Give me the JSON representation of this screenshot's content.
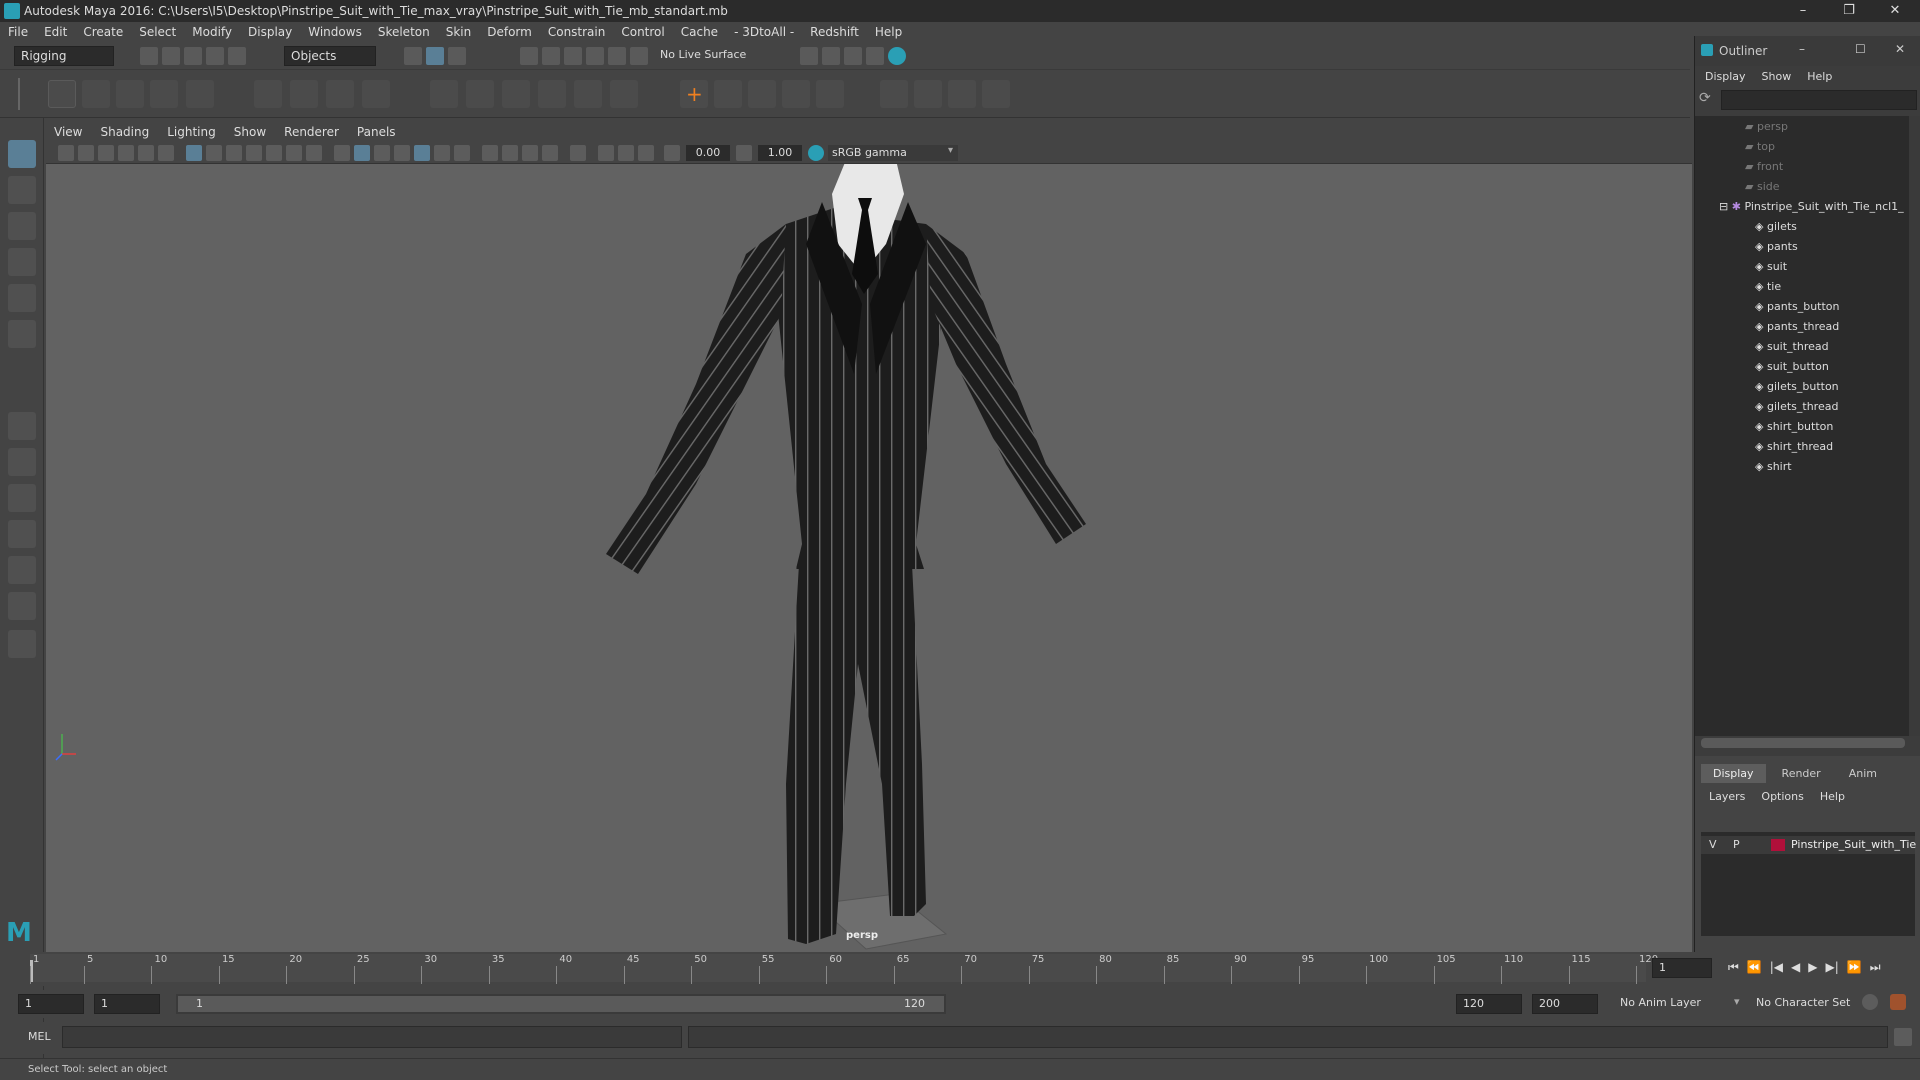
{
  "title": "Autodesk Maya 2016: C:\\Users\\I5\\Desktop\\Pinstripe_Suit_with_Tie_max_vray\\Pinstripe_Suit_with_Tie_mb_standart.mb",
  "menu": [
    "File",
    "Edit",
    "Create",
    "Select",
    "Modify",
    "Display",
    "Windows",
    "Skeleton",
    "Skin",
    "Deform",
    "Constrain",
    "Control",
    "Cache",
    "- 3DtoAll -",
    "Redshift",
    "Help"
  ],
  "status": {
    "mode": "Rigging",
    "select_mode": "Objects",
    "live_surface": "No Live Surface"
  },
  "panel_menu": [
    "View",
    "Shading",
    "Lighting",
    "Show",
    "Renderer",
    "Panels"
  ],
  "panel_toolbar": {
    "exposure": "0.00",
    "gamma": "1.00",
    "color_space": "sRGB gamma"
  },
  "viewport": {
    "camera_label": "persp"
  },
  "outliner": {
    "title": "Outliner",
    "menu": [
      "Display",
      "Show",
      "Help"
    ],
    "cameras": [
      "persp",
      "top",
      "front",
      "side"
    ],
    "root": "Pinstripe_Suit_with_Tie_ncl1_",
    "children": [
      "gilets",
      "pants",
      "suit",
      "tie",
      "pants_button",
      "pants_thread",
      "suit_thread",
      "suit_button",
      "gilets_button",
      "gilets_thread",
      "shirt_button",
      "shirt_thread",
      "shirt"
    ]
  },
  "layers": {
    "tabs": [
      "Display",
      "Render",
      "Anim"
    ],
    "menu": [
      "Layers",
      "Options",
      "Help"
    ],
    "layer": {
      "v": "V",
      "p": "P",
      "name": "Pinstripe_Suit_with_Tie"
    },
    "layer_color": "#b0103a"
  },
  "timeline": {
    "ticks": [
      "1",
      "5",
      "10",
      "15",
      "20",
      "25",
      "30",
      "35",
      "40",
      "45",
      "50",
      "55",
      "60",
      "65",
      "70",
      "75",
      "80",
      "85",
      "90",
      "95",
      "100",
      "105",
      "110",
      "115",
      "120"
    ],
    "current_frame": "1"
  },
  "range": {
    "start": "1",
    "start2": "1",
    "slider_start": "1",
    "slider_end": "120",
    "end": "120",
    "end2": "200",
    "anim_layer": "No Anim Layer",
    "char_set": "No Character Set"
  },
  "cmd": {
    "lang": "MEL"
  },
  "help": "Select Tool: select an object",
  "accent": "#2a9fb5"
}
